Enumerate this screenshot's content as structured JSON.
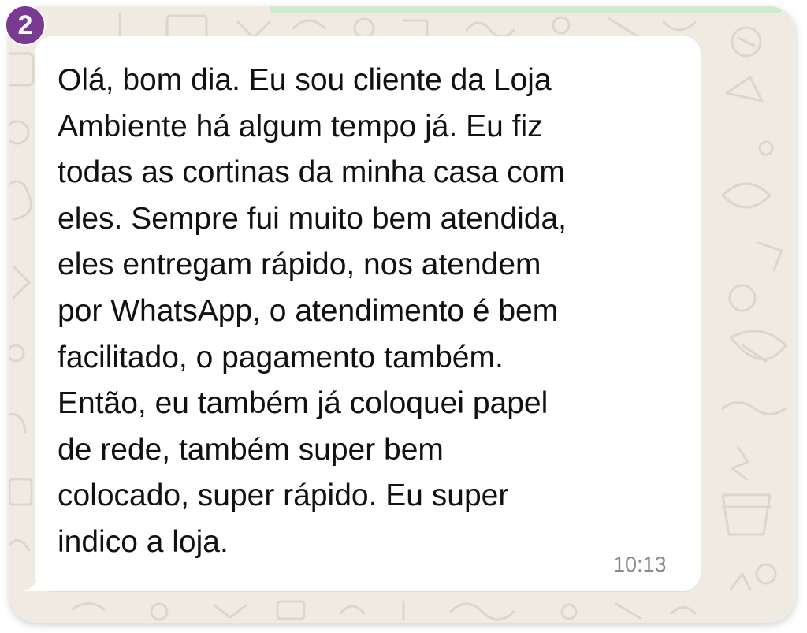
{
  "badge": {
    "number": "2",
    "color": "#7a3a92"
  },
  "chat": {
    "background_color": "#efeae2",
    "accent_bar_color": "#cdeccd"
  },
  "message": {
    "text": "Olá, bom dia. Eu sou cliente da Loja\nAmbiente há algum tempo já. Eu fiz\ntodas as cortinas da minha casa com\neles. Sempre fui muito bem atendida,\neles entregam rápido, nos atendem\npor WhatsApp, o atendimento é bem\nfacilitado, o pagamento também.\nEntão, eu também já coloquei papel\nde rede, também super bem\ncolocado, super rápido. Eu super\nindico a loja.",
    "time": "10:13",
    "bubble_color": "#ffffff"
  }
}
